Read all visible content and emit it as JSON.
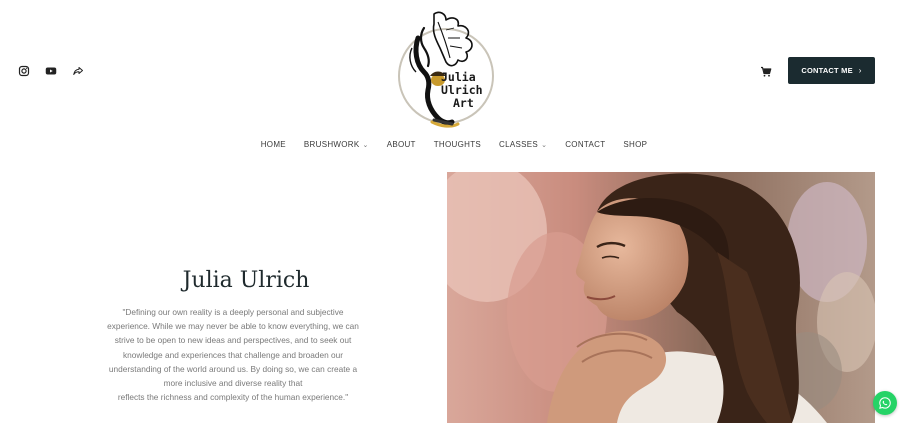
{
  "social": {
    "icons": [
      "instagram-icon",
      "youtube-icon",
      "share-icon"
    ]
  },
  "logo": {
    "line1": "Julia",
    "line2": "Ulrich",
    "line3": "Art"
  },
  "header": {
    "cart_icon": "cart-icon",
    "contact_label": "CONTACT ME",
    "contact_chevron": "›",
    "contact_bg": "#1b2b30"
  },
  "nav": {
    "items": [
      {
        "label": "HOME",
        "dropdown": false
      },
      {
        "label": "BRUSHWORK",
        "dropdown": true
      },
      {
        "label": "ABOUT",
        "dropdown": false
      },
      {
        "label": "THOUGHTS",
        "dropdown": false
      },
      {
        "label": "CLASSES",
        "dropdown": true
      },
      {
        "label": "CONTACT",
        "dropdown": false
      },
      {
        "label": "SHOP",
        "dropdown": false
      }
    ],
    "caret": "⌄"
  },
  "hero": {
    "title": "Julia Ulrich",
    "quote_lines": [
      "\"Defining our own reality is a deeply personal and subjective",
      "experience. While we may never be able to know everything, we can",
      "strive to be open to new ideas and perspectives, and to seek out",
      "knowledge and experiences that challenge and broaden our",
      "understanding of the world around us. By doing so, we can create a",
      "more inclusive and diverse reality that",
      "reflects the richness and complexity of the human experience.\""
    ]
  },
  "widgets": {
    "whatsapp_icon": "whatsapp-icon",
    "whatsapp_color": "#25d366"
  }
}
